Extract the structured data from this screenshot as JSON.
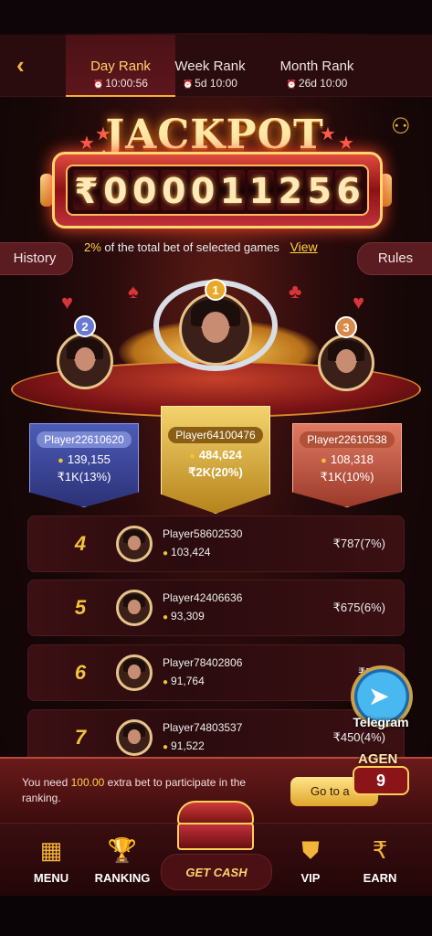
{
  "tabs": [
    {
      "label": "Day Rank",
      "sub": "10:00:56"
    },
    {
      "label": "Week Rank",
      "sub": "5d 10:00"
    },
    {
      "label": "Month Rank",
      "sub": "26d 10:00"
    }
  ],
  "jackpot": {
    "title": "JACKPOT",
    "digits": [
      "₹",
      "0",
      "0",
      "0",
      "0",
      "1",
      "1",
      "2",
      "5",
      "6"
    ],
    "percent": "2%",
    "note": "of the total bet of selected games",
    "view_label": "View",
    "history_label": "History",
    "rules_label": "Rules"
  },
  "podium": [
    {
      "rank": "1",
      "name": "Player64100476",
      "coins": "484,624",
      "prize": "₹2K(20%)"
    },
    {
      "rank": "2",
      "name": "Player22610620",
      "coins": "139,155",
      "prize": "₹1K(13%)"
    },
    {
      "rank": "3",
      "name": "Player22610538",
      "coins": "108,318",
      "prize": "₹1K(10%)"
    }
  ],
  "list": [
    {
      "rank": "4",
      "name": "Player58602530",
      "coins": "103,424",
      "prize": "₹787(7%)"
    },
    {
      "rank": "5",
      "name": "Player42406636",
      "coins": "93,309",
      "prize": "₹675(6%)"
    },
    {
      "rank": "6",
      "name": "Player78402806",
      "coins": "91,764",
      "prize": "₹562"
    },
    {
      "rank": "7",
      "name": "Player74803537",
      "coins": "91,522",
      "prize": "₹450(4%)"
    }
  ],
  "telegram_label": "Telegram",
  "notice": {
    "prefix": "You need ",
    "amount": "100.00",
    "suffix": " extra bet to participate in the ranking.",
    "button": "Go to a",
    "gen_label": "AGEN",
    "gen_value": "9"
  },
  "nav": {
    "menu": "MENU",
    "ranking": "RANKING",
    "get_cash": "GET CASH",
    "vip": "VIP",
    "earn": "EARN"
  },
  "colors": {
    "accent_gold": "#f5c23c",
    "jackpot_red": "#8c1115",
    "rank2_blue": "#4c5bb6",
    "rank3_copper": "#e07a62"
  }
}
